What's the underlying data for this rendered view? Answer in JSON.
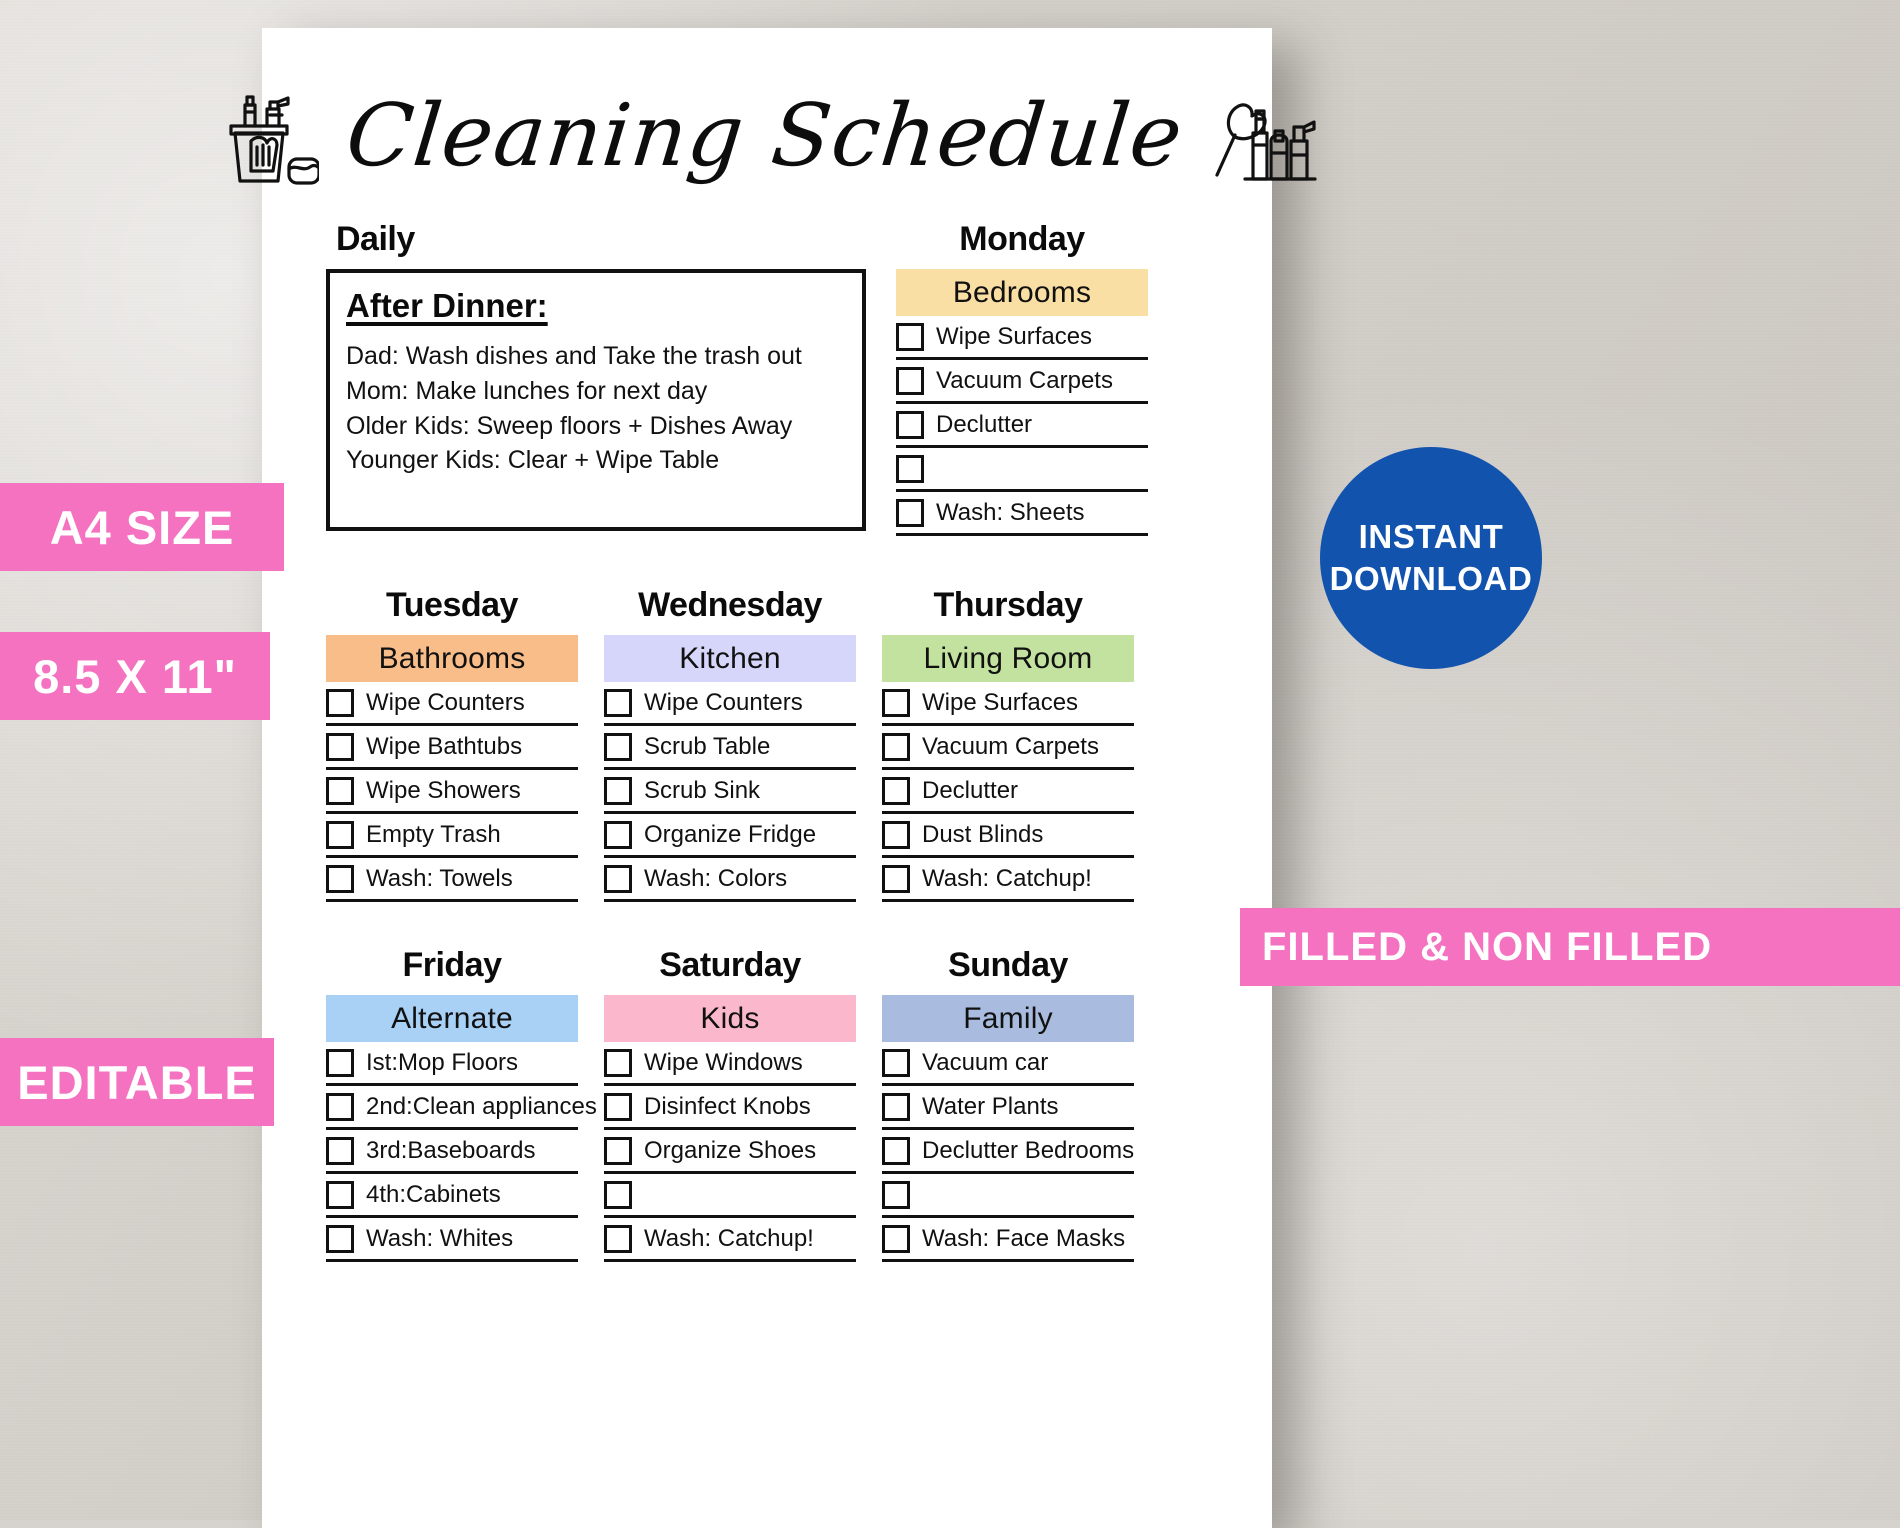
{
  "document": {
    "title": "Cleaning Schedule",
    "icon_left": "cleaning-bucket-icon",
    "icon_right": "cleaning-supplies-icon"
  },
  "daily": {
    "heading": "Daily",
    "box_heading": "After Dinner:",
    "lines": [
      "Dad: Wash dishes and Take the trash out",
      "Mom: Make lunches for next day",
      "Older Kids: Sweep floors + Dishes Away",
      " Younger Kids: Clear + Wipe Table"
    ]
  },
  "days": [
    {
      "name": "Monday",
      "category": "Bedrooms",
      "color": "#fadfa4",
      "tasks": [
        "Wipe Surfaces",
        "Vacuum Carpets",
        "Declutter",
        "",
        "Wash: Sheets"
      ]
    },
    {
      "name": "Tuesday",
      "category": "Bathrooms",
      "color": "#f9bd8a",
      "tasks": [
        "Wipe Counters",
        "Wipe Bathtubs",
        "Wipe Showers",
        "Empty Trash",
        "Wash: Towels"
      ]
    },
    {
      "name": "Wednesday",
      "category": "Kitchen",
      "color": "#d6d6fb",
      "tasks": [
        "Wipe Counters",
        "Scrub Table",
        "Scrub Sink",
        "Organize Fridge",
        "Wash: Colors"
      ]
    },
    {
      "name": "Thursday",
      "category": "Living Room",
      "color": "#c3e2a0",
      "tasks": [
        "Wipe Surfaces",
        "Vacuum Carpets",
        "Declutter",
        "Dust Blinds",
        "Wash: Catchup!"
      ]
    },
    {
      "name": "Friday",
      "category": "Alternate",
      "color": "#a9d0f5",
      "tasks": [
        "Ist:Mop Floors",
        "2nd:Clean appliances",
        "3rd:Baseboards",
        "4th:Cabinets",
        "Wash: Whites"
      ]
    },
    {
      "name": "Saturday",
      "category": "Kids",
      "color": "#fbb8cc",
      "tasks": [
        "Wipe Windows",
        "Disinfect Knobs",
        "Organize Shoes",
        "",
        "Wash: Catchup!"
      ]
    },
    {
      "name": "Sunday",
      "category": "Family",
      "color": "#a9bcdf",
      "tasks": [
        "Vacuum car",
        "Water Plants",
        "Declutter Bedrooms",
        "",
        "Wash: Face Masks"
      ]
    }
  ],
  "badges": {
    "a4": "A4 SIZE",
    "inches": "8.5 X 11\"",
    "editable": "EDITABLE",
    "filled": "FILLED & NON FILLED",
    "instant_line1": "INSTANT",
    "instant_line2": "DOWNLOAD",
    "pink": "#f472c0",
    "blue": "#1253ad"
  }
}
